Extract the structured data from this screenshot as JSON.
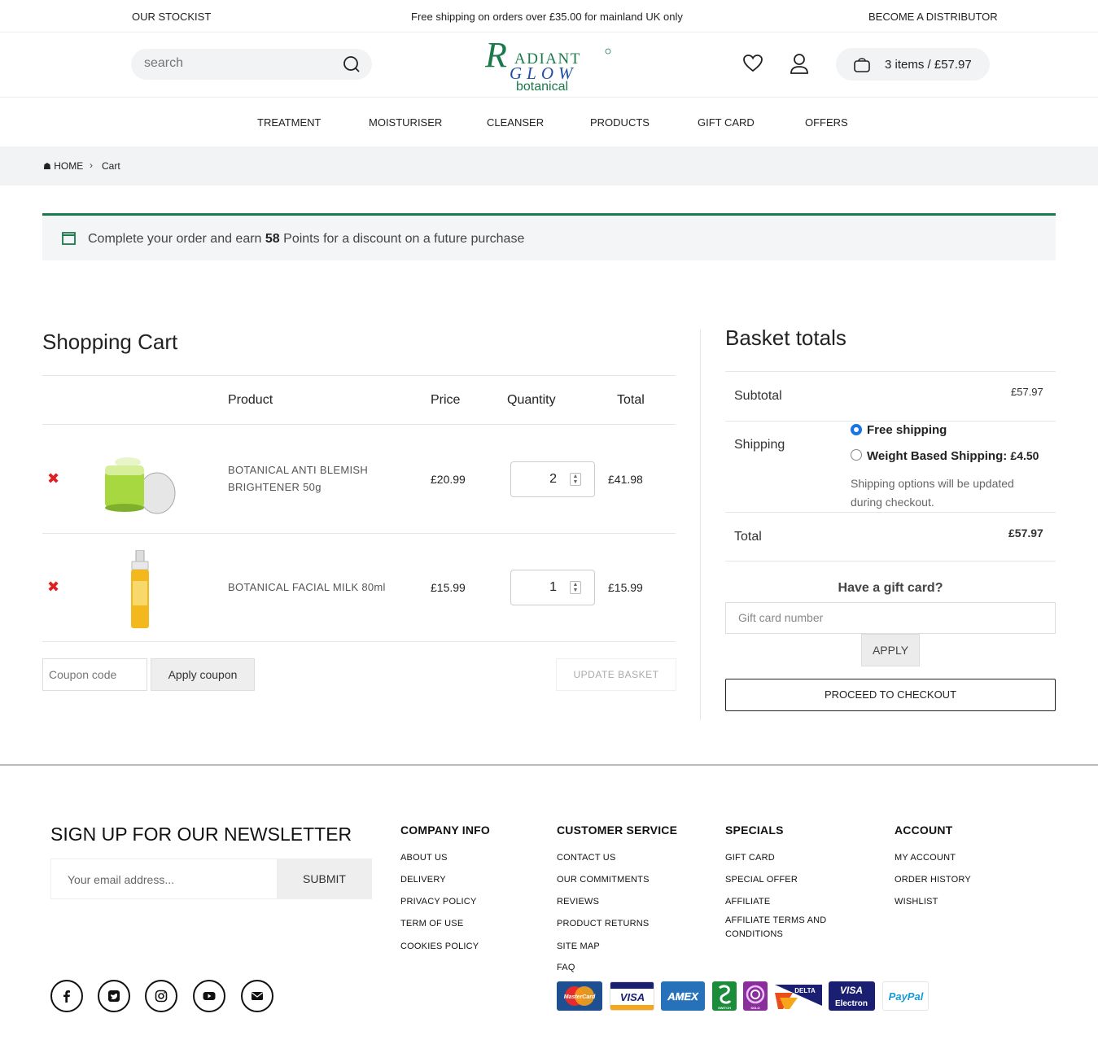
{
  "topbar": {
    "left": "OUR STOCKIST",
    "center": "Free shipping on orders over £35.00 for mainland UK only",
    "right": "BECOME A DISTRIBUTOR"
  },
  "header": {
    "search_placeholder": "search",
    "logo": {
      "line1": "ADIANT",
      "line2": "GLOW",
      "line3": "botanical",
      "initial": "R"
    },
    "cart_summary": "3 items / £57.97"
  },
  "nav": [
    "TREATMENT",
    "MOISTURISER",
    "CLEANSER",
    "PRODUCTS",
    "GIFT CARD",
    "OFFERS"
  ],
  "breadcrumb": {
    "home": "HOME",
    "current": "Cart"
  },
  "notice": {
    "prefix": "Complete your order and earn",
    "points": "58",
    "suffix": "Points for a discount on a future purchase"
  },
  "cart": {
    "title": "Shopping Cart",
    "columns": {
      "product": "Product",
      "price": "Price",
      "quantity": "Quantity",
      "total": "Total"
    },
    "items": [
      {
        "name": "BOTANICAL ANTI BLEMISH BRIGHTENER 50g",
        "price": "£20.99",
        "qty": "2",
        "total": "£41.98"
      },
      {
        "name": "BOTANICAL FACIAL MILK 80ml",
        "price": "£15.99",
        "qty": "1",
        "total": "£15.99"
      }
    ],
    "coupon_placeholder": "Coupon code",
    "apply_coupon": "Apply coupon",
    "update_basket": "UPDATE BASKET"
  },
  "totals": {
    "title": "Basket totals",
    "subtotal_label": "Subtotal",
    "subtotal": "£57.97",
    "shipping_label": "Shipping",
    "ship_free": "Free shipping",
    "ship_weight": "Weight Based Shipping:",
    "ship_weight_price": "£4.50",
    "ship_note": "Shipping options will be updated during checkout.",
    "total_label": "Total",
    "total": "£57.97",
    "gift_title": "Have a gift card?",
    "gift_placeholder": "Gift card number",
    "gift_apply": "APPLY",
    "checkout": "PROCEED TO CHECKOUT"
  },
  "footer": {
    "newsletter_title": "SIGN UP FOR OUR NEWSLETTER",
    "email_placeholder": "Your email address...",
    "submit": "SUBMIT",
    "columns": [
      {
        "title": "COMPANY INFO",
        "links": [
          "ABOUT US",
          "DELIVERY",
          "PRIVACY POLICY",
          "TERM OF USE",
          "COOKIES POLICY"
        ]
      },
      {
        "title": "CUSTOMER SERVICE",
        "links": [
          "CONTACT US",
          "OUR COMMITMENTS",
          "REVIEWS",
          "PRODUCT RETURNS",
          "SITE MAP",
          "FAQ"
        ]
      },
      {
        "title": "SPECIALS",
        "links": [
          "GIFT CARD",
          "SPECIAL OFFER",
          "AFFILIATE",
          "AFFILIATE TERMS AND CONDITIONS"
        ]
      },
      {
        "title": "ACCOUNT",
        "links": [
          "MY ACCOUNT",
          "ORDER HISTORY",
          "WISHLIST"
        ]
      }
    ],
    "payments": [
      "MasterCard",
      "VISA",
      "AMEX",
      "SWITCH",
      "SOLO",
      "DELTA",
      "VISA Electron",
      "PayPal"
    ]
  },
  "colors": {
    "accent_green": "#1a7a4c",
    "remove_red": "#e02020",
    "radio_blue": "#1a73e8"
  }
}
